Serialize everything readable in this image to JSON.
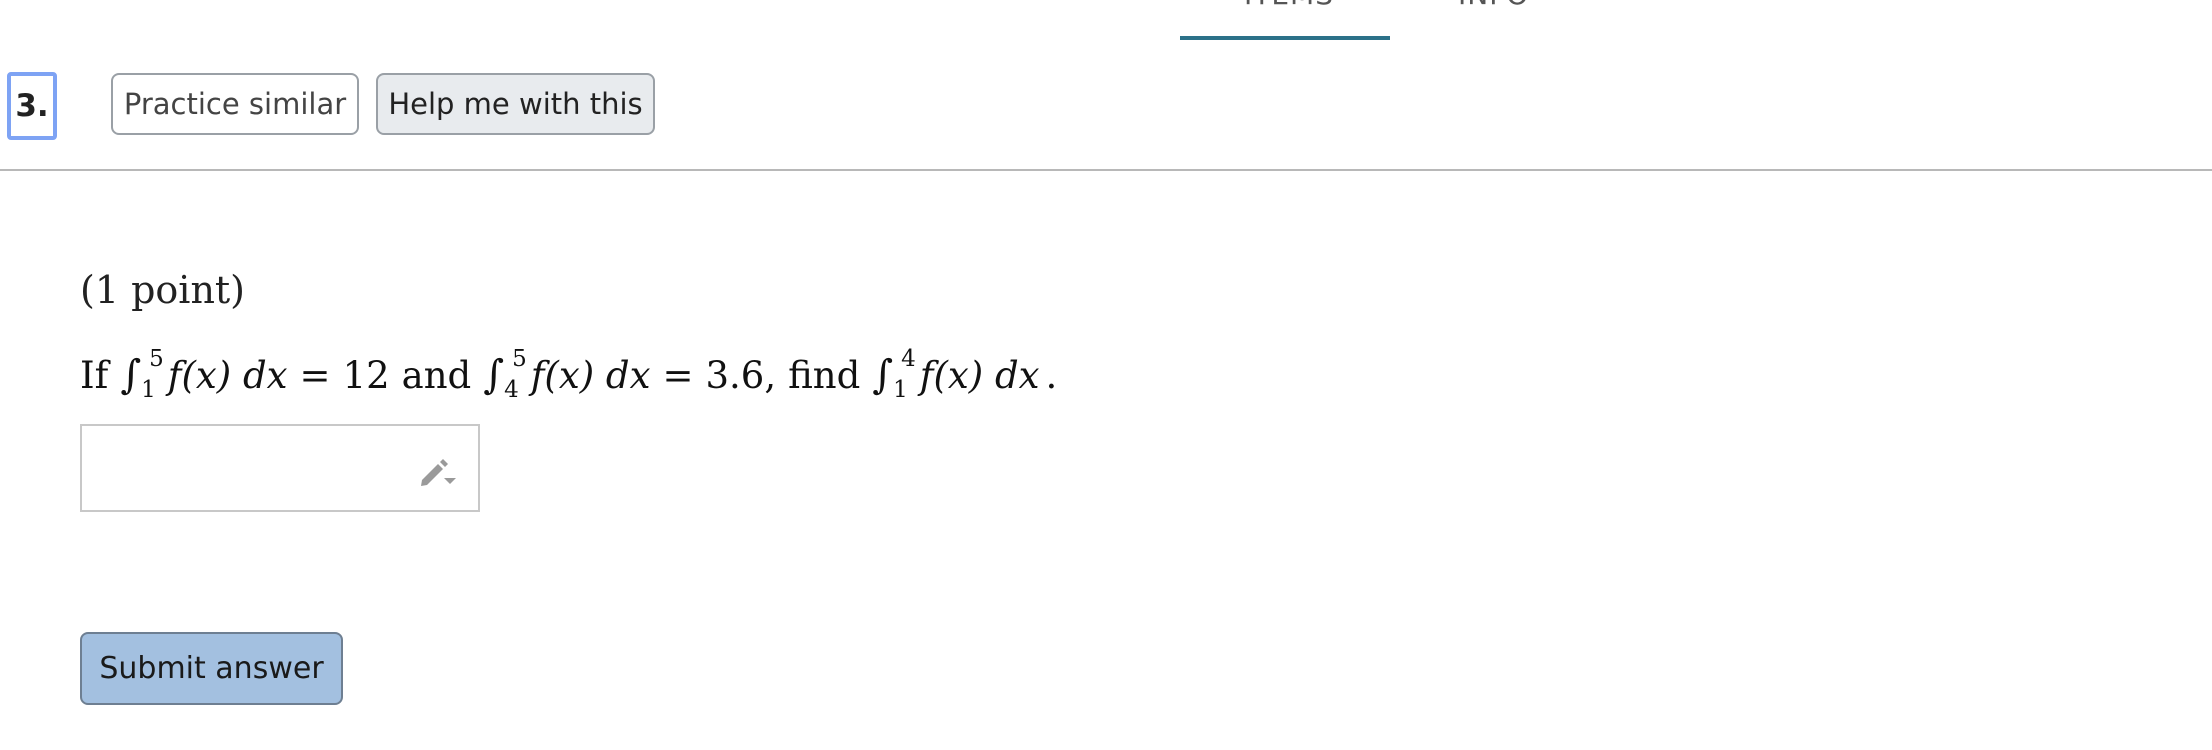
{
  "tabs": {
    "items_label": "ITEMS",
    "info_label": "INFO",
    "active_color": "#2b7189"
  },
  "header": {
    "question_number": "3.",
    "practice_label": "Practice similar",
    "help_label": "Help me with this"
  },
  "problem": {
    "points": "(1 point)",
    "if_word": "If",
    "and_word": "and",
    "find_word": "find",
    "integral1": {
      "lower": "1",
      "upper": "5",
      "value": "12"
    },
    "integral2": {
      "lower": "4",
      "upper": "5",
      "value": "3.6"
    },
    "integral3": {
      "lower": "1",
      "upper": "4"
    },
    "integrand": "f(x) dx",
    "equals": "=",
    "comma": ",",
    "period": "."
  },
  "answer": {
    "value": "",
    "placeholder": "",
    "icon": "pencil-icon"
  },
  "submit": {
    "label": "Submit answer",
    "color": "#a3c0e0"
  }
}
